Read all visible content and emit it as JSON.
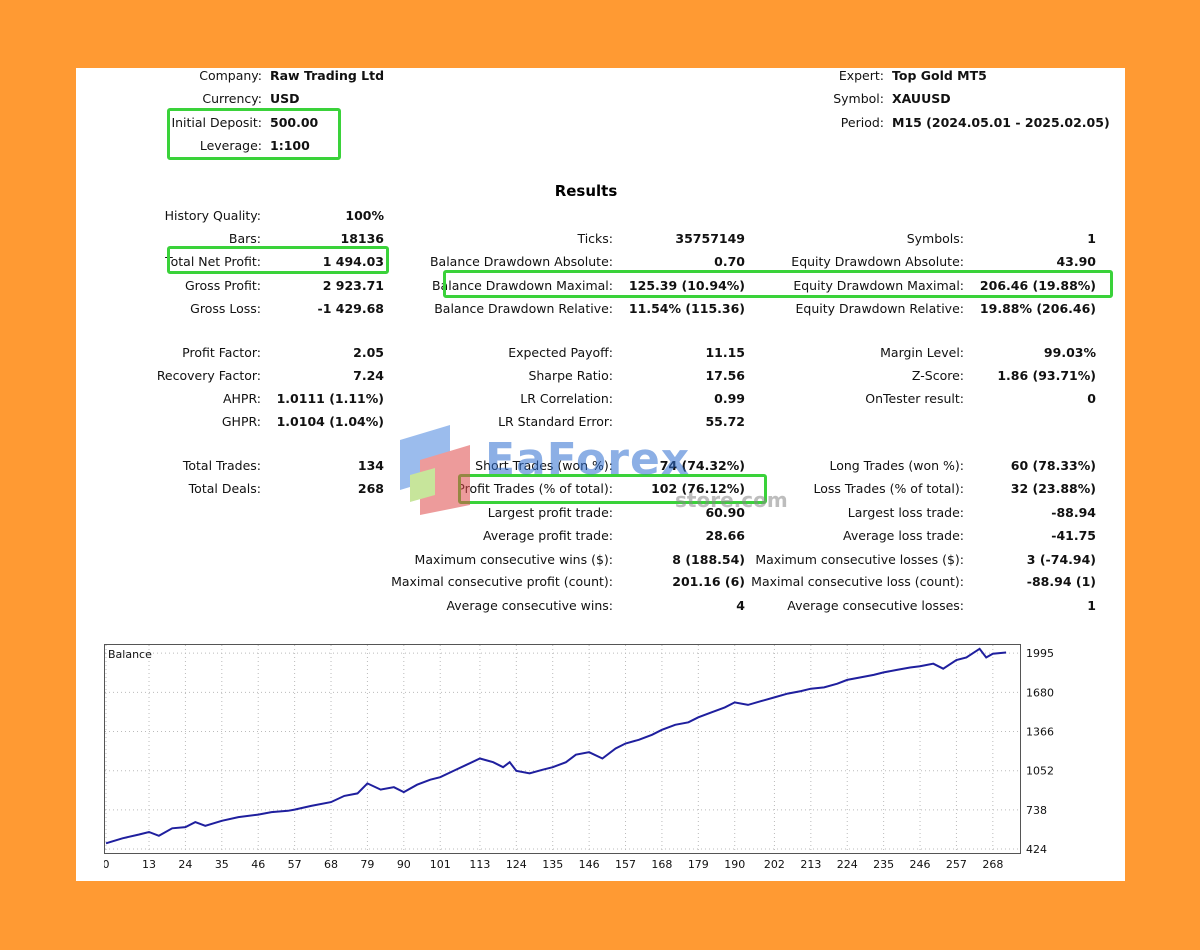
{
  "header": {
    "company_label": "Company:",
    "company": "Raw Trading Ltd",
    "currency_label": "Currency:",
    "currency": "USD",
    "deposit_label": "Initial Deposit:",
    "deposit": "500.00",
    "leverage_label": "Leverage:",
    "leverage": "1:100",
    "expert_label": "Expert:",
    "expert": "Top Gold MT5",
    "symbol_label": "Symbol:",
    "symbol": "XAUUSD",
    "period_label": "Period:",
    "period": "M15 (2024.05.01 - 2025.02.05)"
  },
  "results_title": "Results",
  "stats": {
    "history_quality": {
      "label": "History Quality:",
      "value": "100%"
    },
    "bars": {
      "label": "Bars:",
      "value": "18136"
    },
    "total_net_profit": {
      "label": "Total Net Profit:",
      "value": "1 494.03"
    },
    "gross_profit": {
      "label": "Gross Profit:",
      "value": "2 923.71"
    },
    "gross_loss": {
      "label": "Gross Loss:",
      "value": "-1 429.68"
    },
    "ticks": {
      "label": "Ticks:",
      "value": "35757149"
    },
    "balance_dd_abs": {
      "label": "Balance Drawdown Absolute:",
      "value": "0.70"
    },
    "balance_dd_max": {
      "label": "Balance Drawdown Maximal:",
      "value": "125.39 (10.94%)"
    },
    "balance_dd_rel": {
      "label": "Balance Drawdown Relative:",
      "value": "11.54% (115.36)"
    },
    "symbols": {
      "label": "Symbols:",
      "value": "1"
    },
    "equity_dd_abs": {
      "label": "Equity Drawdown Absolute:",
      "value": "43.90"
    },
    "equity_dd_max": {
      "label": "Equity Drawdown Maximal:",
      "value": "206.46 (19.88%)"
    },
    "equity_dd_rel": {
      "label": "Equity Drawdown Relative:",
      "value": "19.88% (206.46)"
    },
    "profit_factor": {
      "label": "Profit Factor:",
      "value": "2.05"
    },
    "recovery_factor": {
      "label": "Recovery Factor:",
      "value": "7.24"
    },
    "ahpr": {
      "label": "AHPR:",
      "value": "1.0111 (1.11%)"
    },
    "ghpr": {
      "label": "GHPR:",
      "value": "1.0104 (1.04%)"
    },
    "expected_payoff": {
      "label": "Expected Payoff:",
      "value": "11.15"
    },
    "sharpe_ratio": {
      "label": "Sharpe Ratio:",
      "value": "17.56"
    },
    "lr_correlation": {
      "label": "LR Correlation:",
      "value": "0.99"
    },
    "lr_std_error": {
      "label": "LR Standard Error:",
      "value": "55.72"
    },
    "margin_level": {
      "label": "Margin Level:",
      "value": "99.03%"
    },
    "z_score": {
      "label": "Z-Score:",
      "value": "1.86 (93.71%)"
    },
    "ontester": {
      "label": "OnTester result:",
      "value": "0"
    },
    "total_trades": {
      "label": "Total Trades:",
      "value": "134"
    },
    "total_deals": {
      "label": "Total Deals:",
      "value": "268"
    },
    "short_trades": {
      "label": "Short Trades (won %):",
      "value": "74 (74.32%)"
    },
    "profit_trades": {
      "label": "Profit Trades (% of total):",
      "value": "102 (76.12%)"
    },
    "largest_profit": {
      "label": "Largest profit trade:",
      "value": "60.90"
    },
    "avg_profit": {
      "label": "Average profit trade:",
      "value": "28.66"
    },
    "max_consec_wins": {
      "label": "Maximum consecutive wins ($):",
      "value": "8 (188.54)"
    },
    "maximal_consec_profit": {
      "label": "Maximal consecutive profit (count):",
      "value": "201.16 (6)"
    },
    "avg_consec_wins": {
      "label": "Average consecutive wins:",
      "value": "4"
    },
    "long_trades": {
      "label": "Long Trades (won %):",
      "value": "60 (78.33%)"
    },
    "loss_trades": {
      "label": "Loss Trades (% of total):",
      "value": "32 (23.88%)"
    },
    "largest_loss": {
      "label": "Largest loss trade:",
      "value": "-88.94"
    },
    "avg_loss": {
      "label": "Average loss trade:",
      "value": "-41.75"
    },
    "max_consec_losses": {
      "label": "Maximum consecutive losses ($):",
      "value": "3 (-74.94)"
    },
    "maximal_consec_loss": {
      "label": "Maximal consecutive loss (count):",
      "value": "-88.94 (1)"
    },
    "avg_consec_losses": {
      "label": "Average consecutive losses:",
      "value": "1"
    }
  },
  "watermark": {
    "brand": "EaForex",
    "sub": "store.com"
  },
  "colors": {
    "background": "#FF9A33",
    "highlight": "#3ad23a",
    "line": "#1f1f9e"
  },
  "chart_data": {
    "type": "line",
    "title": "Balance",
    "x_ticks": [
      0,
      13,
      24,
      35,
      46,
      57,
      68,
      79,
      90,
      101,
      113,
      124,
      135,
      146,
      157,
      168,
      179,
      190,
      202,
      213,
      224,
      235,
      246,
      257,
      268
    ],
    "y_ticks": [
      424,
      738,
      1052,
      1366,
      1680,
      1995
    ],
    "xlim": [
      0,
      275
    ],
    "ylim": [
      424,
      2020
    ],
    "grid": true,
    "series": [
      {
        "points": [
          [
            0,
            470
          ],
          [
            5,
            510
          ],
          [
            10,
            540
          ],
          [
            13,
            560
          ],
          [
            16,
            530
          ],
          [
            20,
            590
          ],
          [
            24,
            600
          ],
          [
            27,
            640
          ],
          [
            30,
            610
          ],
          [
            35,
            650
          ],
          [
            40,
            680
          ],
          [
            46,
            700
          ],
          [
            50,
            720
          ],
          [
            55,
            730
          ],
          [
            57,
            740
          ],
          [
            62,
            770
          ],
          [
            68,
            800
          ],
          [
            72,
            850
          ],
          [
            76,
            870
          ],
          [
            79,
            950
          ],
          [
            83,
            900
          ],
          [
            87,
            920
          ],
          [
            90,
            880
          ],
          [
            94,
            940
          ],
          [
            98,
            980
          ],
          [
            101,
            1000
          ],
          [
            105,
            1050
          ],
          [
            109,
            1100
          ],
          [
            113,
            1150
          ],
          [
            117,
            1120
          ],
          [
            120,
            1080
          ],
          [
            122,
            1120
          ],
          [
            124,
            1050
          ],
          [
            128,
            1030
          ],
          [
            132,
            1060
          ],
          [
            135,
            1080
          ],
          [
            139,
            1120
          ],
          [
            142,
            1180
          ],
          [
            146,
            1200
          ],
          [
            150,
            1150
          ],
          [
            154,
            1230
          ],
          [
            157,
            1270
          ],
          [
            161,
            1300
          ],
          [
            165,
            1340
          ],
          [
            168,
            1380
          ],
          [
            172,
            1420
          ],
          [
            176,
            1440
          ],
          [
            179,
            1480
          ],
          [
            183,
            1520
          ],
          [
            187,
            1560
          ],
          [
            190,
            1600
          ],
          [
            194,
            1580
          ],
          [
            198,
            1610
          ],
          [
            202,
            1640
          ],
          [
            206,
            1670
          ],
          [
            210,
            1690
          ],
          [
            213,
            1710
          ],
          [
            217,
            1720
          ],
          [
            221,
            1750
          ],
          [
            224,
            1780
          ],
          [
            228,
            1800
          ],
          [
            232,
            1820
          ],
          [
            235,
            1840
          ],
          [
            239,
            1860
          ],
          [
            243,
            1880
          ],
          [
            246,
            1890
          ],
          [
            250,
            1910
          ],
          [
            253,
            1870
          ],
          [
            257,
            1940
          ],
          [
            260,
            1960
          ],
          [
            264,
            2030
          ],
          [
            266,
            1960
          ],
          [
            268,
            1990
          ],
          [
            272,
            2000
          ]
        ]
      }
    ]
  }
}
